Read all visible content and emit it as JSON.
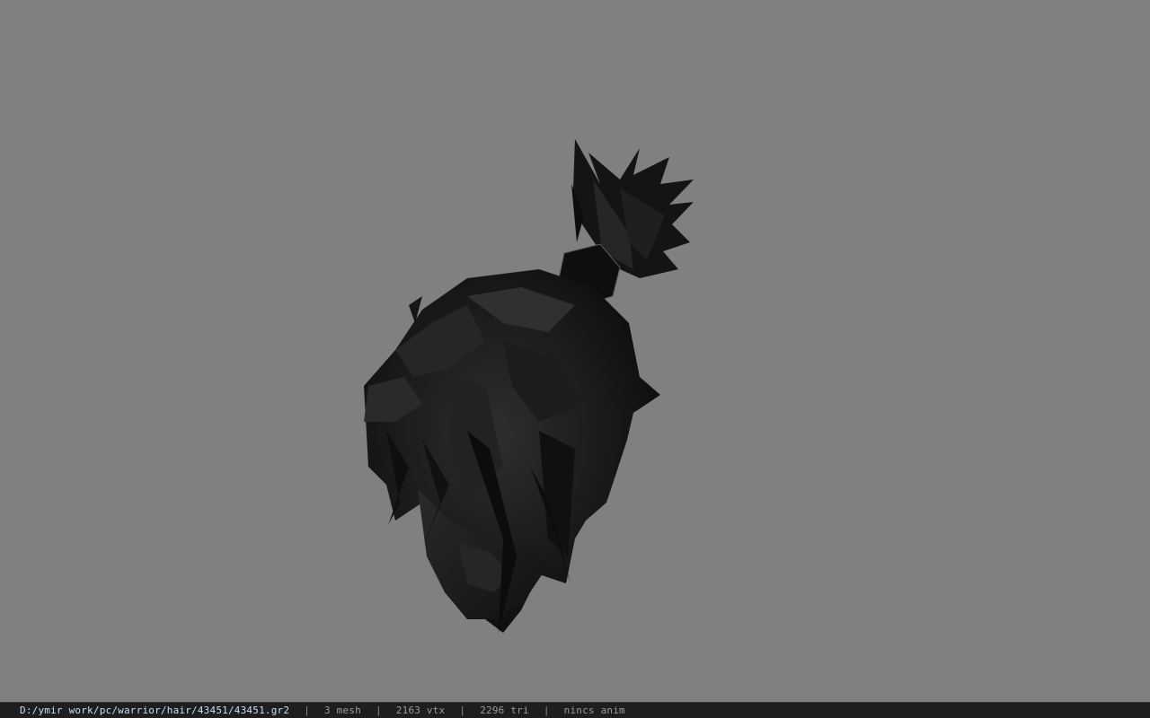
{
  "viewer": {
    "background_color": "#808080",
    "model_icon": "hair-model-icon",
    "model_color": "#141414"
  },
  "statusbar": {
    "file_path": "D:/ymir work/pc/warrior/hair/43451/43451.gr2",
    "mesh_count": "3 mesh",
    "vertex_count": "2163 vtx",
    "triangle_count": "2296 tri",
    "animation_status": "nincs anim",
    "separator": "|"
  }
}
